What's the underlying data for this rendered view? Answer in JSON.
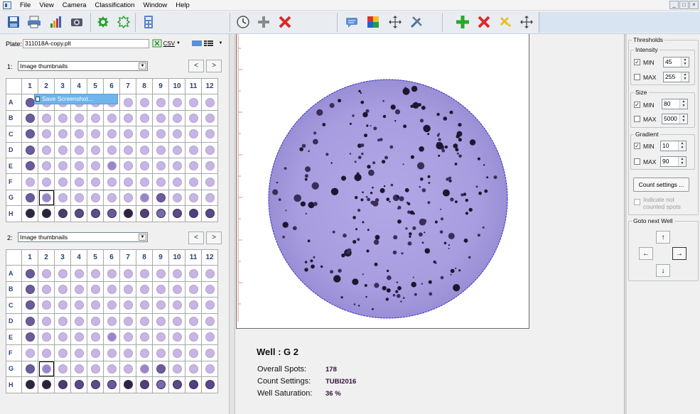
{
  "menu": [
    "File",
    "View",
    "Camera",
    "Classification",
    "Window",
    "Help"
  ],
  "window_buttons": [
    "_",
    "□",
    "×"
  ],
  "plate": {
    "label": "Plate:",
    "file": "311018A-copy.plt",
    "csv_label": "CSV"
  },
  "selectors": [
    {
      "index": "1:",
      "value": "Image thumbnails"
    },
    {
      "index": "2:",
      "value": "Image thumbnails"
    }
  ],
  "nav": {
    "prev": "<",
    "next": ">"
  },
  "columns": [
    "1",
    "2",
    "3",
    "4",
    "5",
    "6",
    "7",
    "8",
    "9",
    "10",
    "11",
    "12"
  ],
  "rows": [
    "A",
    "B",
    "C",
    "D",
    "E",
    "F",
    "G",
    "H"
  ],
  "context_menu": {
    "item": "Save Screenshot..."
  },
  "well": {
    "title": "Well :  G 2"
  },
  "stats": [
    {
      "label": "Overall Spots:",
      "value": "178"
    },
    {
      "label": "Count Settings:",
      "value": "TUBI2016"
    },
    {
      "label": "Well Saturation:",
      "value": "36 %"
    }
  ],
  "thresholds": {
    "title": "Thresholds",
    "intensity": {
      "title": "Intensity",
      "min_label": "MIN",
      "min": "45",
      "max_label": "MAX",
      "max": "255",
      "min_checked": true,
      "max_checked": false
    },
    "size": {
      "title": "Size",
      "min_label": "MIN",
      "min": "80",
      "max_label": "MAX",
      "max": "5000",
      "min_checked": true,
      "max_checked": false
    },
    "gradient": {
      "title": "Gradient",
      "min_label": "MIN",
      "min": "10",
      "max_label": "MAX",
      "max": "90",
      "min_checked": true,
      "max_checked": false
    },
    "count_settings_button": "Count settings ...",
    "indicate_label_1": "Indicate not",
    "indicate_label_2": "counted spots"
  },
  "goto": {
    "title": "Goto next Well",
    "up": "↑",
    "down": "↓",
    "left": "←",
    "right": "→"
  },
  "colors": {
    "well_bg": "#a99ee0",
    "spot": "#2a1f3d",
    "accent_blue": "#2f6fd0",
    "selection": "#6fb4ea"
  }
}
